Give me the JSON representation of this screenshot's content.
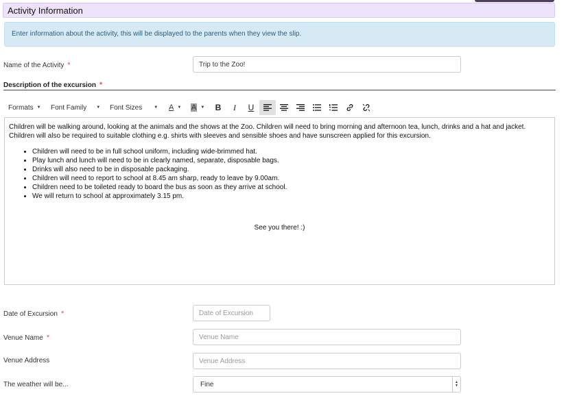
{
  "section": {
    "title": "Activity Information"
  },
  "info": {
    "text": "Enter information about the activity, this will be displayed to the parents when they view the slip."
  },
  "fields": {
    "activity_name": {
      "label": "Name of the Activity",
      "value": "Trip to the Zoo!"
    },
    "description": {
      "label": "Description of the excursion"
    },
    "date": {
      "label": "Date of Excursion",
      "placeholder": "Date of Excursion"
    },
    "venue_name": {
      "label": "Venue Name",
      "placeholder": "Venue Name"
    },
    "venue_address": {
      "label": "Venue Address",
      "placeholder": "Venue Address"
    },
    "weather": {
      "label": "The weather will be...",
      "value": "Fine"
    }
  },
  "required_marker": "*",
  "toolbar": {
    "formats": "Formats",
    "font_family": "Font Family",
    "font_sizes": "Font Sizes",
    "text_color_glyph": "A",
    "bg_color_glyph": "A",
    "bold_glyph": "B",
    "italic_glyph": "I",
    "underline_glyph": "U"
  },
  "editor": {
    "paragraph": "Children will be walking around, looking at the animals and the shows at the Zoo. Children will need to bring morning and afternoon tea, lunch, drinks and a hat and jacket. Children will also be required to suitable clothing e.g. shirts with sleeves and sensible shoes and have sunscreen applied for this excursion.",
    "bullets": [
      " Children will need to be in full school uniform, including wide-brimmed hat.",
      "Play lunch and lunch will need to be in clearly named, separate, disposable bags.",
      "Drinks will also need to be in disposable packaging.",
      "Children will need to report to school at 8.45 am sharp, ready to leave by 9.00am.",
      "Children need to be toileted ready to board the bus as soon as they arrive at school.",
      "We will return to school at approximately 3.15 pm."
    ],
    "closing": "See you there! :)"
  },
  "colors": {
    "header_bg": "#ede3fb",
    "info_bg": "#d6eaf5",
    "info_text": "#2a5d7c",
    "required": "#e05252"
  }
}
